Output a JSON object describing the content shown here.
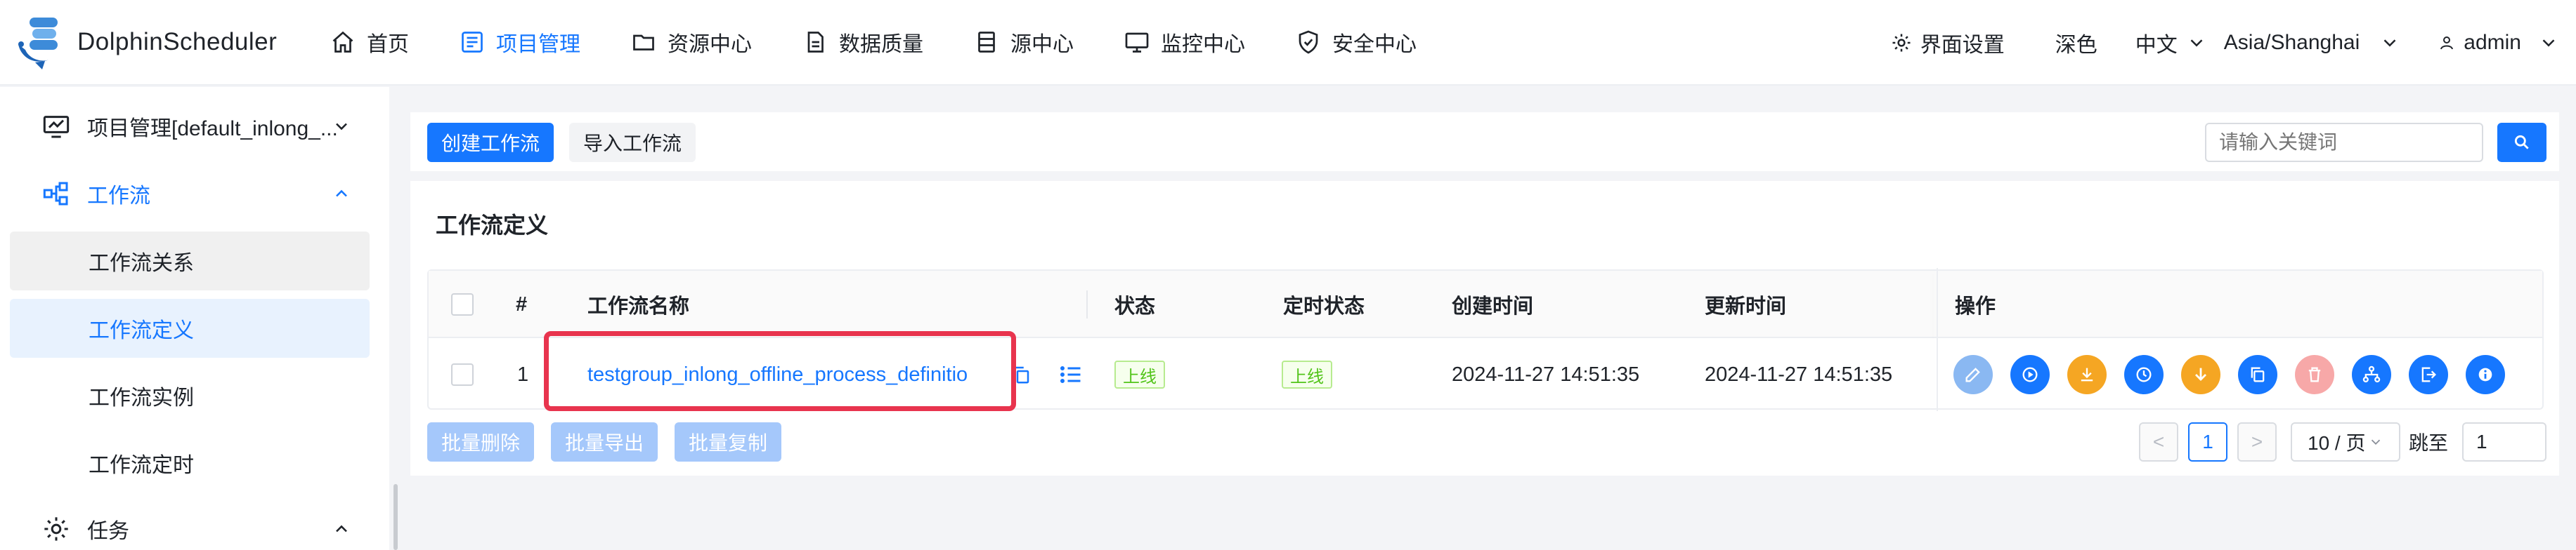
{
  "app": {
    "name": "DolphinScheduler"
  },
  "nav": {
    "items": [
      {
        "label": "首页",
        "icon": "home-icon"
      },
      {
        "label": "项目管理",
        "icon": "project-icon",
        "active": true
      },
      {
        "label": "资源中心",
        "icon": "folder-icon"
      },
      {
        "label": "数据质量",
        "icon": "data-quality-icon"
      },
      {
        "label": "源中心",
        "icon": "datasource-icon"
      },
      {
        "label": "监控中心",
        "icon": "monitor-icon"
      },
      {
        "label": "安全中心",
        "icon": "shield-icon"
      }
    ],
    "ui_settings": "界面设置",
    "theme": "深色",
    "language": "中文",
    "timezone": "Asia/Shanghai",
    "user": "admin"
  },
  "sidebar": {
    "project": "项目管理[default_inlong_...",
    "workflow_group": "工作流",
    "items": [
      "工作流关系",
      "工作流定义",
      "工作流实例",
      "工作流定时"
    ],
    "active_item": "工作流定义",
    "task_group": "任务"
  },
  "toolbar": {
    "create_label": "创建工作流",
    "import_label": "导入工作流",
    "search_placeholder": "请输入关键词"
  },
  "card": {
    "title": "工作流定义",
    "columns": [
      "#",
      "工作流名称",
      "状态",
      "定时状态",
      "创建时间",
      "更新时间",
      "操作"
    ],
    "rows": [
      {
        "index": "1",
        "name": "testgroup_inlong_offline_process_definitio",
        "status": "上线",
        "schedule_status": "上线",
        "created": "2024-11-27 14:51:35",
        "updated": "2024-11-27 14:51:35"
      }
    ],
    "ops": [
      {
        "icon": "edit-icon",
        "color": "#8ab8f2"
      },
      {
        "icon": "run-icon",
        "color": "#1677ff"
      },
      {
        "icon": "publish-icon",
        "color": "#f5a623"
      },
      {
        "icon": "timing-icon",
        "color": "#1677ff"
      },
      {
        "icon": "offline-icon",
        "color": "#f5a623"
      },
      {
        "icon": "copy-icon",
        "color": "#1677ff"
      },
      {
        "icon": "delete-icon",
        "color": "#f7a8a8"
      },
      {
        "icon": "tree-icon",
        "color": "#1677ff"
      },
      {
        "icon": "export-icon",
        "color": "#1677ff"
      },
      {
        "icon": "info-icon",
        "color": "#1677ff"
      }
    ]
  },
  "batch": {
    "delete_label": "批量删除",
    "export_label": "批量导出",
    "copy_label": "批量复制"
  },
  "pagination": {
    "prev": "<",
    "current": "1",
    "next": ">",
    "page_size": "10 / 页",
    "jump_label": "跳至",
    "jump_value": "1"
  },
  "colors": {
    "primary": "#1677ff",
    "highlight": "#e8344e",
    "online_tag": "#52c41a"
  }
}
